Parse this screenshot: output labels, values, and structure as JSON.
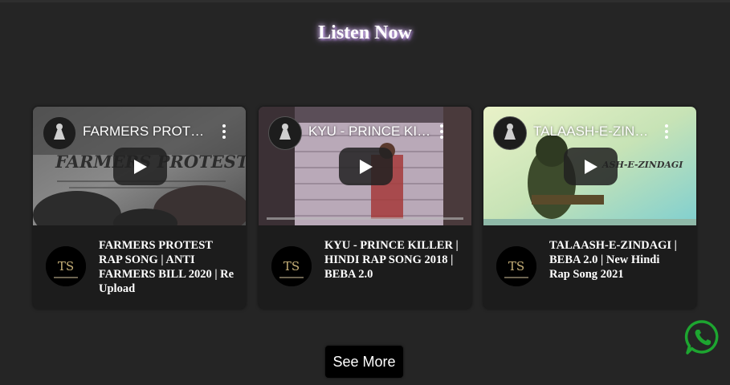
{
  "section": {
    "heading": "Listen Now"
  },
  "videos": [
    {
      "embed_title": "FARMERS PROTEST RAP SONG | ANTI FARMERS BILL 2020 | Re Upload",
      "title": "FARMERS PROTEST RAP SONG | ANTI FARMERS BILL 2020 | Re Upload",
      "thumb_text": "FARMERS PROTEST RAP"
    },
    {
      "embed_title": "KYU - PRINCE KILLER | HINDI RAP SONG 2018 | BEBA 2.0",
      "title": "KYU - PRINCE KILLER | HINDI RAP SONG 2018 | BEBA 2.0"
    },
    {
      "embed_title": "TALAASH-E-ZINDAGI | BEBA 2.0 | New Hindi Rap Song 2021",
      "title": "TALAASH-E-ZINDAGI | BEBA 2.0 | New Hindi Rap Song 2021",
      "thumb_text": "ASH-E-ZINDAGI"
    }
  ],
  "channel_logo": {
    "monogram": "TS"
  },
  "see_more": {
    "label": "See More"
  },
  "colors": {
    "background": "#252525",
    "card": "#1c1c1c",
    "button": "#000000",
    "whatsapp": "#1da530",
    "glow": "#b98be6"
  },
  "icons": {
    "play": "play-icon",
    "kebab": "kebab-menu-icon",
    "whatsapp": "whatsapp-icon"
  }
}
